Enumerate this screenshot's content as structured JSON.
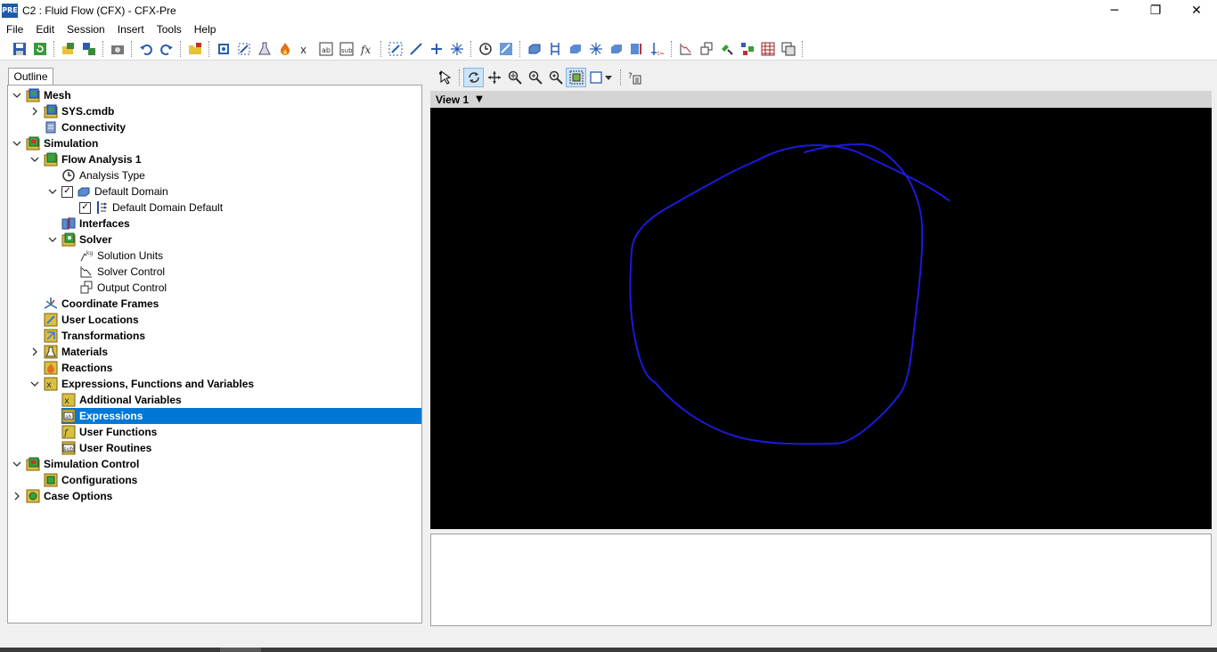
{
  "window": {
    "app_icon": "PRE",
    "title": "C2 : Fluid Flow (CFX) - CFX-Pre",
    "minimize": "─",
    "maximize": "❐",
    "close": "✕"
  },
  "menu": [
    "File",
    "Edit",
    "Session",
    "Insert",
    "Tools",
    "Help"
  ],
  "outline": {
    "tab_label": "Outline",
    "tree": [
      {
        "label": "Mesh",
        "bold": true,
        "expander": "open",
        "icon": "mesh-icon"
      },
      {
        "label": "SYS.cmdb",
        "bold": true,
        "expander": "closed",
        "icon": "mesh-icon"
      },
      {
        "label": "Connectivity",
        "bold": true,
        "expander": "",
        "icon": "connectivity-icon"
      },
      {
        "label": "Simulation",
        "bold": true,
        "expander": "open",
        "icon": "simulation-icon"
      },
      {
        "label": "Flow Analysis 1",
        "bold": true,
        "expander": "open",
        "icon": "flow-analysis-icon"
      },
      {
        "label": "Analysis Type",
        "bold": false,
        "expander": "",
        "icon": "clock-icon"
      },
      {
        "label": "Default Domain",
        "bold": false,
        "expander": "open",
        "icon": "domain-icon",
        "checked": true
      },
      {
        "label": "Default Domain Default",
        "bold": false,
        "expander": "",
        "icon": "boundary-icon",
        "checked": true
      },
      {
        "label": "Interfaces",
        "bold": true,
        "expander": "",
        "icon": "interfaces-icon"
      },
      {
        "label": "Solver",
        "bold": true,
        "expander": "open",
        "icon": "solver-icon"
      },
      {
        "label": "Solution Units",
        "bold": false,
        "expander": "",
        "icon": "units-icon"
      },
      {
        "label": "Solver Control",
        "bold": false,
        "expander": "",
        "icon": "solver-control-icon"
      },
      {
        "label": "Output Control",
        "bold": false,
        "expander": "",
        "icon": "output-control-icon"
      },
      {
        "label": "Coordinate Frames",
        "bold": true,
        "expander": "",
        "icon": "axes-icon"
      },
      {
        "label": "User Locations",
        "bold": true,
        "expander": "",
        "icon": "locations-icon"
      },
      {
        "label": "Transformations",
        "bold": true,
        "expander": "",
        "icon": "transform-icon"
      },
      {
        "label": "Materials",
        "bold": true,
        "expander": "closed",
        "icon": "flask-icon"
      },
      {
        "label": "Reactions",
        "bold": true,
        "expander": "",
        "icon": "flame-icon"
      },
      {
        "label": "Expressions, Functions and Variables",
        "bold": true,
        "expander": "open",
        "icon": "variables-icon"
      },
      {
        "label": "Additional Variables",
        "bold": true,
        "expander": "",
        "icon": "variables-icon"
      },
      {
        "label": "Expressions",
        "bold": true,
        "expander": "",
        "icon": "expression-icon",
        "selected": true
      },
      {
        "label": "User Functions",
        "bold": true,
        "expander": "",
        "icon": "function-icon"
      },
      {
        "label": "User Routines",
        "bold": true,
        "expander": "",
        "icon": "sub-icon"
      },
      {
        "label": "Simulation Control",
        "bold": true,
        "expander": "open",
        "icon": "simulation-icon"
      },
      {
        "label": "Configurations",
        "bold": true,
        "expander": "",
        "icon": "config-icon"
      },
      {
        "label": "Case Options",
        "bold": true,
        "expander": "closed",
        "icon": "case-options-icon"
      }
    ]
  },
  "viewer": {
    "view_name": "View 1",
    "view_caret": "▼"
  }
}
